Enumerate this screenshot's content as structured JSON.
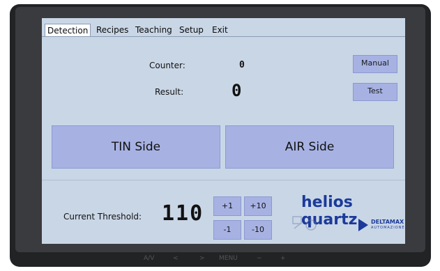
{
  "tabs": [
    "Detection",
    "Recipes",
    "Teaching",
    "Setup",
    "Exit"
  ],
  "counter": {
    "label": "Counter:",
    "value": "0"
  },
  "result": {
    "label": "Result:",
    "value": "0"
  },
  "buttons": {
    "manual": "Manual",
    "test": "Test"
  },
  "sides": {
    "tin": "TIN Side",
    "air": "AIR Side"
  },
  "threshold": {
    "label": "Current Threshold:",
    "value": "110",
    "plus1": "+1",
    "plus10": "+10",
    "minus1": "-1",
    "minus10": "-10"
  },
  "logo": {
    "brand": "helios quartz",
    "partner": "DELTAMAX",
    "partner_sub": "AUTOMAZIONE"
  },
  "hardware_controls": [
    "A/V",
    "<",
    ">",
    "MENU",
    "−",
    "+"
  ],
  "colors": {
    "screen_bg": "#c9d6e6",
    "button_bg": "#a7b2e3",
    "brand_blue": "#1c3a9a",
    "bezel": "#222325"
  }
}
